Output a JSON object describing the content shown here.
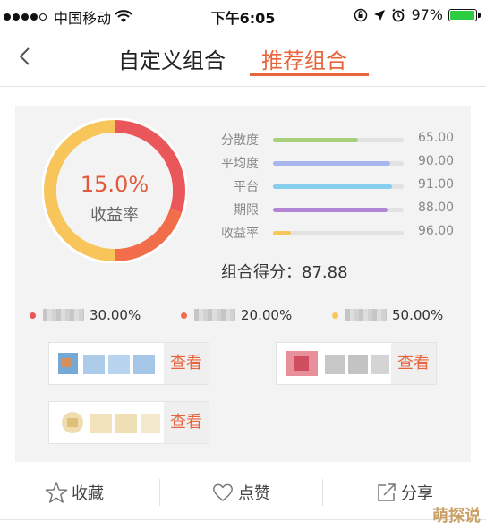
{
  "status_bar": {
    "carrier": "中国移动",
    "time": "下午6:05",
    "battery": "97%",
    "battery_level": 0.97
  },
  "nav": {
    "tabs": [
      {
        "label": "自定义组合",
        "active": false
      },
      {
        "label": "推荐组合",
        "active": true
      }
    ],
    "accent_color": "#e8643c"
  },
  "portfolio": {
    "return_value": "15.0%",
    "return_label": "收益率",
    "segments": [
      {
        "color": "#e9575b",
        "percent": 30.0
      },
      {
        "color": "#f26d4a",
        "percent": 20.0
      },
      {
        "color": "#f7c55a",
        "percent": 50.0
      }
    ],
    "metrics": [
      {
        "label": "分散度",
        "value": "65.00",
        "fraction": 0.65,
        "color": "#a8d07a"
      },
      {
        "label": "平均度",
        "value": "90.00",
        "fraction": 0.9,
        "color": "#a8b6f0"
      },
      {
        "label": "平台",
        "value": "91.00",
        "fraction": 0.91,
        "color": "#86cdef"
      },
      {
        "label": "期限",
        "value": "88.00",
        "fraction": 0.88,
        "color": "#b184d4"
      },
      {
        "label": "收益率",
        "value": "96.00",
        "fraction": 0.14,
        "color": "#f7c55a"
      }
    ],
    "score_label": "组合得分：",
    "score_value": "87.88",
    "legend": [
      {
        "percent_text": "30.00%",
        "color": "#e9575b"
      },
      {
        "percent_text": "20.00%",
        "color": "#f26d4a"
      },
      {
        "percent_text": "50.00%",
        "color": "#f7c55a"
      }
    ],
    "view_label": "查看"
  },
  "actions": [
    {
      "label": "收藏",
      "icon": "star-icon"
    },
    {
      "label": "点赞",
      "icon": "heart-icon"
    },
    {
      "label": "分享",
      "icon": "share-icon"
    }
  ],
  "watermark": "萌探说"
}
